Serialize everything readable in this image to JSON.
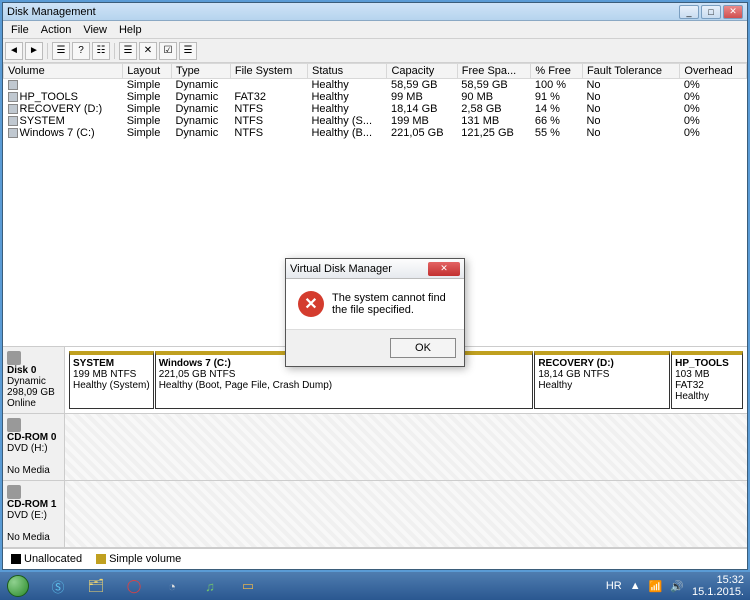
{
  "window": {
    "title": "Disk Management",
    "menu": [
      "File",
      "Action",
      "View",
      "Help"
    ]
  },
  "columns": [
    "Volume",
    "Layout",
    "Type",
    "File System",
    "Status",
    "Capacity",
    "Free Spa...",
    "% Free",
    "Fault Tolerance",
    "Overhead"
  ],
  "volumes": [
    {
      "vol": "",
      "layout": "Simple",
      "type": "Dynamic",
      "fs": "",
      "status": "Healthy",
      "cap": "58,59 GB",
      "free": "58,59 GB",
      "pct": "100 %",
      "ft": "No",
      "ovh": "0%"
    },
    {
      "vol": "HP_TOOLS",
      "layout": "Simple",
      "type": "Dynamic",
      "fs": "FAT32",
      "status": "Healthy",
      "cap": "99 MB",
      "free": "90 MB",
      "pct": "91 %",
      "ft": "No",
      "ovh": "0%"
    },
    {
      "vol": "RECOVERY (D:)",
      "layout": "Simple",
      "type": "Dynamic",
      "fs": "NTFS",
      "status": "Healthy",
      "cap": "18,14 GB",
      "free": "2,58 GB",
      "pct": "14 %",
      "ft": "No",
      "ovh": "0%"
    },
    {
      "vol": "SYSTEM",
      "layout": "Simple",
      "type": "Dynamic",
      "fs": "NTFS",
      "status": "Healthy (S...",
      "cap": "199 MB",
      "free": "131 MB",
      "pct": "66 %",
      "ft": "No",
      "ovh": "0%"
    },
    {
      "vol": "Windows 7 (C:)",
      "layout": "Simple",
      "type": "Dynamic",
      "fs": "NTFS",
      "status": "Healthy (B...",
      "cap": "221,05 GB",
      "free": "121,25 GB",
      "pct": "55 %",
      "ft": "No",
      "ovh": "0%"
    }
  ],
  "disks": [
    {
      "name": "Disk 0",
      "kind": "Dynamic",
      "size": "298,09 GB",
      "state": "Online",
      "parts": [
        {
          "title": "SYSTEM",
          "sub": "199 MB NTFS",
          "status": "Healthy (System)",
          "w": 12
        },
        {
          "title": "Windows 7  (C:)",
          "sub": "221,05 GB NTFS",
          "status": "Healthy (Boot, Page File, Crash Dump)",
          "w": 58
        },
        {
          "title": "RECOVERY  (D:)",
          "sub": "18,14 GB NTFS",
          "status": "Healthy",
          "w": 20
        },
        {
          "title": "HP_TOOLS",
          "sub": "103 MB FAT32",
          "status": "Healthy",
          "w": 10
        }
      ]
    },
    {
      "name": "CD-ROM 0",
      "kind": "DVD (H:)",
      "size": "",
      "state": "No Media",
      "parts": null
    },
    {
      "name": "CD-ROM 1",
      "kind": "DVD (E:)",
      "size": "",
      "state": "No Media",
      "parts": null
    }
  ],
  "legend": {
    "unalloc": "Unallocated",
    "simple": "Simple volume"
  },
  "dialog": {
    "title": "Virtual Disk Manager",
    "msg": "The system cannot find the file specified.",
    "ok": "OK"
  },
  "tray": {
    "lang": "HR",
    "time": "15:32",
    "date": "15.1.2015."
  }
}
